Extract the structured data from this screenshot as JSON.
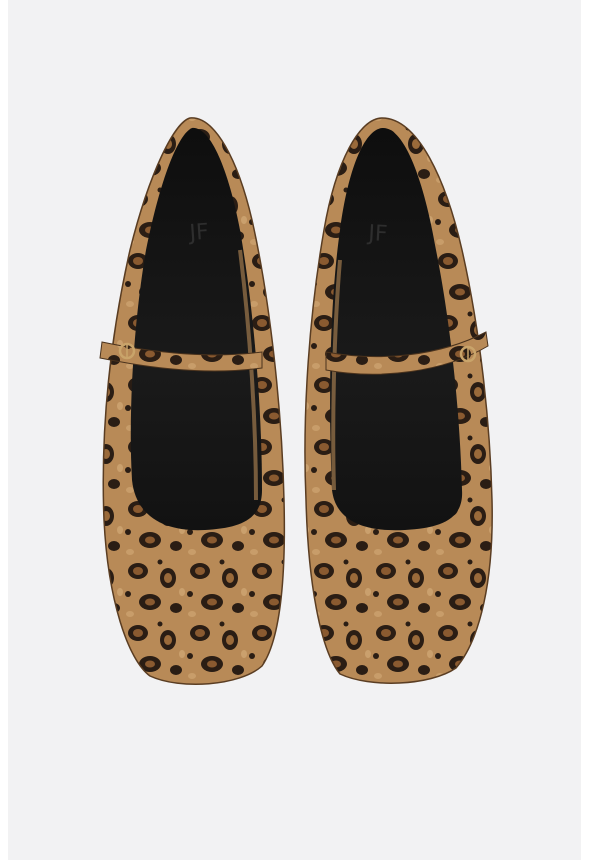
{
  "photo": {
    "subject": "product-photo",
    "background_color": "#f2f2f3",
    "colors": {
      "fur_base": "#b88a57",
      "fur_light": "#d2aa77",
      "spot_ring": "#2a1d14",
      "spot_center": "#8a5a30",
      "lining": "#141414",
      "buckle": "#c9a46a"
    },
    "shoes": [
      {
        "id": "left-shoe",
        "insole_mark": "JF"
      },
      {
        "id": "right-shoe",
        "insole_mark": "JF"
      }
    ]
  }
}
